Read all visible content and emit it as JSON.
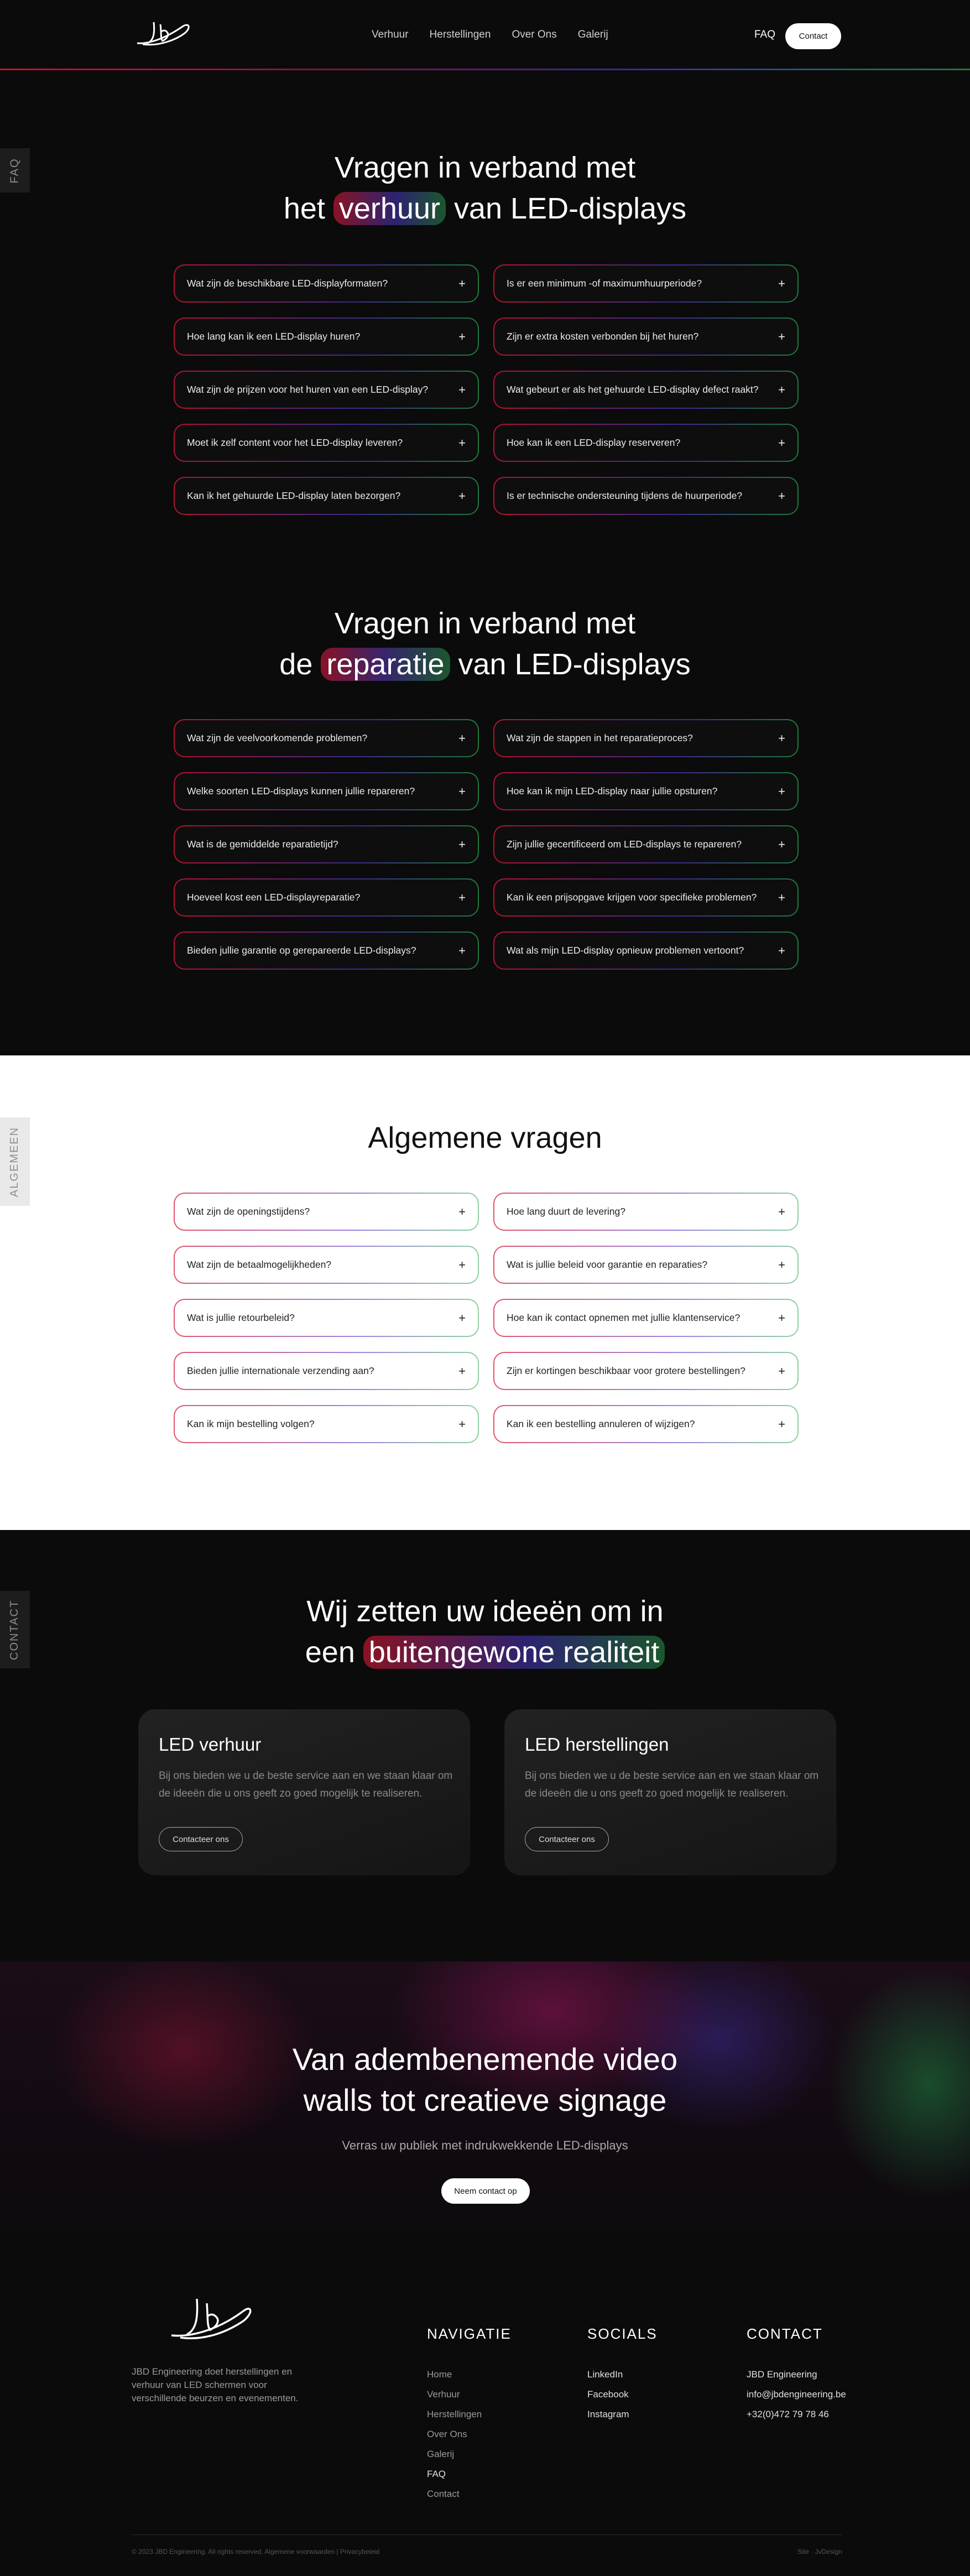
{
  "header": {
    "nav": [
      "Verhuur",
      "Herstellingen",
      "Over Ons",
      "Galerij"
    ],
    "faq": "FAQ",
    "contact": "Contact"
  },
  "sidetabs": {
    "faq": "FAQ",
    "algemeen": "ALGEMEEN",
    "contact": "CONTACT"
  },
  "rental": {
    "title_line1": "Vragen in verband met",
    "title_pre": "het ",
    "title_hl": "verhuur",
    "title_post": " van LED-displays",
    "questions": [
      "Wat zijn de beschikbare LED-displayformaten?",
      "Is er een minimum -of maximumhuurperiode?",
      "Hoe lang kan ik een LED-display huren?",
      "Zijn er extra kosten verbonden bij het huren?",
      "Wat zijn de prijzen voor het huren van een LED-display?",
      "Wat gebeurt er als het gehuurde LED-display defect raakt?",
      "Moet ik zelf content voor het LED-display leveren?",
      "Hoe kan ik een LED-display reserveren?",
      "Kan ik het gehuurde LED-display laten bezorgen?",
      "Is er technische ondersteuning tijdens de huurperiode?"
    ]
  },
  "repair": {
    "title_line1": "Vragen in verband met",
    "title_pre": "de ",
    "title_hl": "reparatie",
    "title_post": " van LED-displays",
    "questions": [
      "Wat zijn de veelvoorkomende problemen?",
      "Wat zijn de stappen in het reparatieproces?",
      "Welke soorten LED-displays kunnen jullie repareren?",
      "Hoe kan ik mijn LED-display naar jullie opsturen?",
      "Wat is de gemiddelde reparatietijd?",
      "Zijn jullie gecertificeerd om LED-displays te repareren?",
      "Hoeveel kost een LED-displayreparatie?",
      "Kan ik een prijsopgave krijgen voor specifieke problemen?",
      "Bieden jullie garantie op gerepareerde LED-displays?",
      "Wat als mijn LED-display opnieuw problemen vertoont?"
    ]
  },
  "general": {
    "title": "Algemene vragen",
    "questions": [
      "Wat zijn de openingstijdens?",
      "Hoe lang duurt de levering?",
      "Wat zijn de betaalmogelijkheden?",
      "Wat is jullie beleid voor garantie en reparaties?",
      "Wat is jullie retourbeleid?",
      "Hoe kan ik contact opnemen met jullie klantenservice?",
      "Bieden jullie internationale verzending aan?",
      "Zijn er kortingen beschikbaar voor grotere bestellingen?",
      "Kan ik mijn bestelling volgen?",
      "Kan ik een bestelling annuleren of wijzigen?"
    ]
  },
  "contact": {
    "title_line1": "Wij zetten uw ideeën om in",
    "title_pre": "een ",
    "title_hl": "buitengewone realiteit",
    "cards": [
      {
        "title": "LED verhuur",
        "text": "Bij ons bieden we u de beste service aan en we staan klaar om de ideeën die u ons geeft zo goed mogelijk te realiseren.",
        "button": "Contacteer ons"
      },
      {
        "title": "LED herstellingen",
        "text": "Bij ons bieden we u de beste service aan en we staan klaar om de ideeën die u ons geeft zo goed mogelijk te realiseren.",
        "button": "Contacteer ons"
      }
    ]
  },
  "cta": {
    "title_line1": "Van adembenemende video",
    "title_line2": "walls tot creatieve signage",
    "subtitle": "Verras uw publiek met indrukwekkende LED-displays",
    "button": "Neem contact op"
  },
  "footer": {
    "description": "JBD Engineering doet herstellingen en verhuur van LED schermen voor verschillende beurzen en evenementen.",
    "nav_title": "NAVIGATIE",
    "nav": [
      "Home",
      "Verhuur",
      "Herstellingen",
      "Over Ons",
      "Galerij",
      "FAQ",
      "Contact"
    ],
    "socials_title": "SOCIALS",
    "socials": [
      "LinkedIn",
      "Facebook",
      "Instagram"
    ],
    "contact_title": "CONTACT",
    "contact": [
      "JBD Engineering",
      "info@jbdengineering.be",
      "+32(0)472 79 78 46"
    ],
    "copyright": "© 2023 JBD Engineering. All rights reserved. Algemene voorwaarden | Privacybeleid",
    "credit": "Site · JvDesign"
  }
}
